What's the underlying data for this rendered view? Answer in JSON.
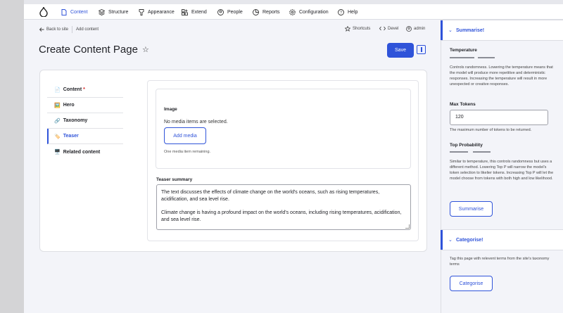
{
  "toolbar": {
    "items": [
      "Content",
      "Structure",
      "Appearance",
      "Extend",
      "People",
      "Reports",
      "Configuration",
      "Help"
    ]
  },
  "breadcrumb": {
    "back": "Back to site",
    "current": "Add content"
  },
  "tools": {
    "shortcuts": "Shortcuts",
    "devel": "Devel",
    "user": "admin"
  },
  "page": {
    "title": "Create Content Page",
    "save_label": "Save"
  },
  "tabs": [
    {
      "label": "Content",
      "icon": "📄",
      "required": "*"
    },
    {
      "label": "Hero",
      "icon": "🖼️"
    },
    {
      "label": "Taxonomy",
      "icon": "🔗"
    },
    {
      "label": "Teaser",
      "icon": "🏷️"
    },
    {
      "label": "Related content",
      "icon": "🖥️"
    }
  ],
  "image_field": {
    "label": "Image",
    "empty_text": "No media items are selected.",
    "add_button": "Add media",
    "remaining": "One media item remaining."
  },
  "teaser": {
    "label": "Teaser summary",
    "paragraph1": "The text discusses the effects of climate change on the world's oceans, such as rising temperatures, acidification, and sea level rise.",
    "paragraph2": "Climate change is having a profound impact on the world's oceans, including rising temperatures, acidification, and sea level rise."
  },
  "summarise": {
    "heading": "Summarise!",
    "temperature_label": "Temperature",
    "temperature_desc": "Controls randomness. Lowering the temperature means that the model will produce more repetitive and deterministic responses. Increasing the temperature will result in more unexpected or creative responses.",
    "max_tokens_label": "Max Tokens",
    "max_tokens_value": "120",
    "max_tokens_desc": "The maximum number of tokens to be returned.",
    "top_p_label": "Top Probability",
    "top_p_desc": "Similar to temperature, this controls randomness but uses a different method. Lowering Top P will narrow the model's token selection to likelier tokens. Increasing Top P will let the model choose from tokens with both high and low likelihood.",
    "button": "Summarise"
  },
  "categorise": {
    "heading": "Categorise!",
    "desc": "Tag this page with relevent terms from the site's taxonomy terms",
    "button": "Categorise"
  },
  "colors": {
    "accent": "#2f53d9",
    "required": "#d72222"
  }
}
